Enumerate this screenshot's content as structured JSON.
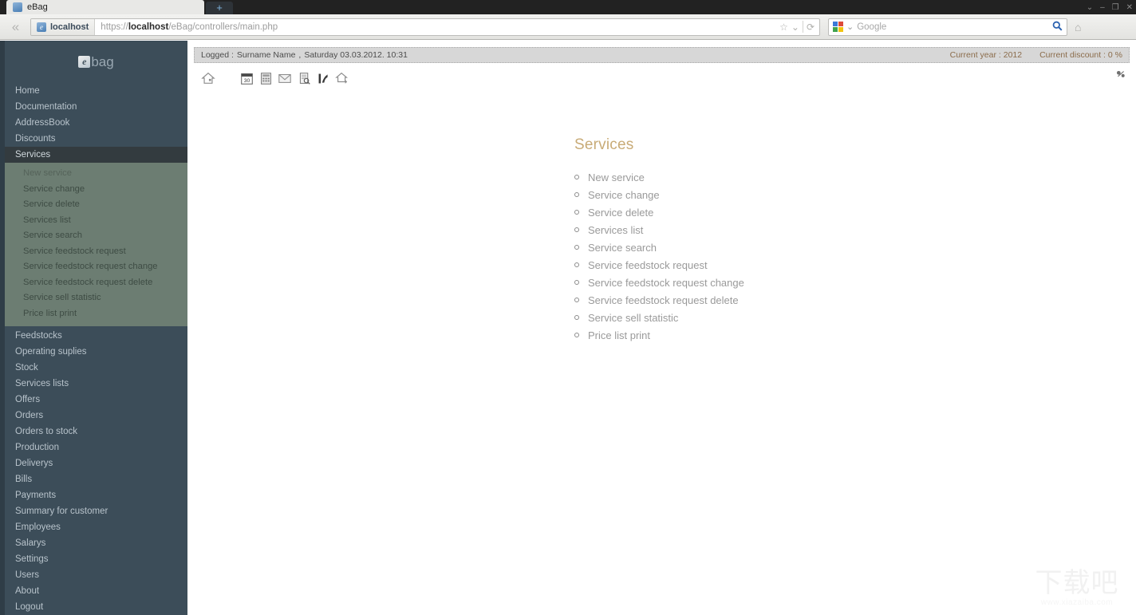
{
  "browser": {
    "tab_title": "eBag",
    "new_tab_label": "+",
    "window_controls": [
      "⌄",
      "–",
      "❐",
      "✕"
    ],
    "back_label": "«",
    "site_identity_host": "localhost",
    "url_prefix": "https://",
    "url_host": "localhost",
    "url_path": "/eBag/controllers/main.php",
    "bookmark_icon": "☆",
    "dropdown_icon": "⌄",
    "reload_icon": "⟳",
    "search_engine": "Google",
    "search_placeholder": "Google",
    "search_icon": "🔍",
    "home_icon": "⌂"
  },
  "sidebar": {
    "logo_mark": "e",
    "logo_word": "bag",
    "items": [
      {
        "label": "Home",
        "active": false
      },
      {
        "label": "Documentation",
        "active": false
      },
      {
        "label": "AddressBook",
        "active": false
      },
      {
        "label": "Discounts",
        "active": false
      },
      {
        "label": "Services",
        "active": true
      },
      {
        "label": "Feedstocks",
        "active": false
      },
      {
        "label": "Operating suplies",
        "active": false
      },
      {
        "label": "Stock",
        "active": false
      },
      {
        "label": "Services lists",
        "active": false
      },
      {
        "label": "Offers",
        "active": false
      },
      {
        "label": "Orders",
        "active": false
      },
      {
        "label": "Orders to stock",
        "active": false
      },
      {
        "label": "Production",
        "active": false
      },
      {
        "label": "Deliverys",
        "active": false
      },
      {
        "label": "Bills",
        "active": false
      },
      {
        "label": "Payments",
        "active": false
      },
      {
        "label": "Summary for customer",
        "active": false
      },
      {
        "label": "Employees",
        "active": false
      },
      {
        "label": "Salarys",
        "active": false
      },
      {
        "label": "Settings",
        "active": false
      },
      {
        "label": "Users",
        "active": false
      },
      {
        "label": "About",
        "active": false
      },
      {
        "label": "Logout",
        "active": false
      }
    ],
    "submenu": [
      "New service",
      "Service change",
      "Service delete",
      "Services list",
      "Service search",
      "Service feedstock request",
      "Service feedstock request change",
      "Service feedstock request delete",
      "Service sell statistic",
      "Price list print"
    ]
  },
  "infobar": {
    "logged_label": "Logged :",
    "user_name": "Surname Name",
    "comma": ",",
    "datetime": "Saturday 03.03.2012. 10:31",
    "current_year_label": "Current year :",
    "current_year_value": "2012",
    "current_discount_label": "Current discount :",
    "current_discount_value": "0",
    "percent": "%"
  },
  "toolbar": {
    "icons": [
      "home-icon",
      "calendar-icon",
      "calculator-icon",
      "mail-icon",
      "document-search-icon",
      "chart-icon",
      "home-export-icon"
    ],
    "calendar_day": "30",
    "decoration": "sparkle-icon"
  },
  "main": {
    "title": "Services",
    "items": [
      "New service",
      "Service change",
      "Service delete",
      "Services list",
      "Service search",
      "Service feedstock request",
      "Service feedstock request change",
      "Service feedstock request delete",
      "Service sell statistic",
      "Price list print"
    ]
  },
  "watermark": {
    "cn_text": "下载吧",
    "site_text": "www.xiazaiba.com"
  },
  "colors": {
    "sidebar_bg": "#3c4d59",
    "submenu_bg": "#6c7d72",
    "active_item_bg": "#333b3f",
    "title_accent": "#c8ab77",
    "infobar_bg": "#d7d7d7",
    "infobar_accent": "#9a7b5a"
  }
}
